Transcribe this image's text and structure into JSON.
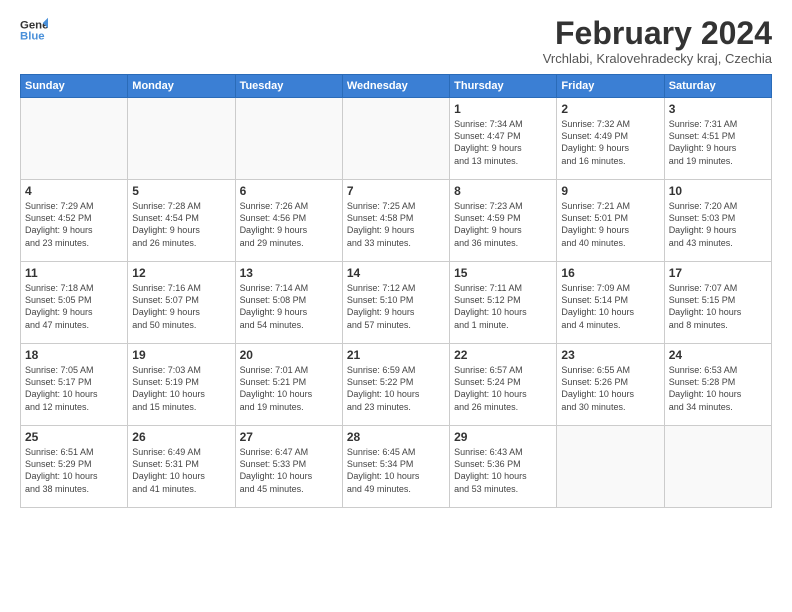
{
  "logo": {
    "line1": "General",
    "line2": "Blue"
  },
  "title": "February 2024",
  "location": "Vrchlabi, Kralovehradecky kraj, Czechia",
  "days_header": [
    "Sunday",
    "Monday",
    "Tuesday",
    "Wednesday",
    "Thursday",
    "Friday",
    "Saturday"
  ],
  "weeks": [
    [
      {
        "day": "",
        "info": ""
      },
      {
        "day": "",
        "info": ""
      },
      {
        "day": "",
        "info": ""
      },
      {
        "day": "",
        "info": ""
      },
      {
        "day": "1",
        "info": "Sunrise: 7:34 AM\nSunset: 4:47 PM\nDaylight: 9 hours\nand 13 minutes."
      },
      {
        "day": "2",
        "info": "Sunrise: 7:32 AM\nSunset: 4:49 PM\nDaylight: 9 hours\nand 16 minutes."
      },
      {
        "day": "3",
        "info": "Sunrise: 7:31 AM\nSunset: 4:51 PM\nDaylight: 9 hours\nand 19 minutes."
      }
    ],
    [
      {
        "day": "4",
        "info": "Sunrise: 7:29 AM\nSunset: 4:52 PM\nDaylight: 9 hours\nand 23 minutes."
      },
      {
        "day": "5",
        "info": "Sunrise: 7:28 AM\nSunset: 4:54 PM\nDaylight: 9 hours\nand 26 minutes."
      },
      {
        "day": "6",
        "info": "Sunrise: 7:26 AM\nSunset: 4:56 PM\nDaylight: 9 hours\nand 29 minutes."
      },
      {
        "day": "7",
        "info": "Sunrise: 7:25 AM\nSunset: 4:58 PM\nDaylight: 9 hours\nand 33 minutes."
      },
      {
        "day": "8",
        "info": "Sunrise: 7:23 AM\nSunset: 4:59 PM\nDaylight: 9 hours\nand 36 minutes."
      },
      {
        "day": "9",
        "info": "Sunrise: 7:21 AM\nSunset: 5:01 PM\nDaylight: 9 hours\nand 40 minutes."
      },
      {
        "day": "10",
        "info": "Sunrise: 7:20 AM\nSunset: 5:03 PM\nDaylight: 9 hours\nand 43 minutes."
      }
    ],
    [
      {
        "day": "11",
        "info": "Sunrise: 7:18 AM\nSunset: 5:05 PM\nDaylight: 9 hours\nand 47 minutes."
      },
      {
        "day": "12",
        "info": "Sunrise: 7:16 AM\nSunset: 5:07 PM\nDaylight: 9 hours\nand 50 minutes."
      },
      {
        "day": "13",
        "info": "Sunrise: 7:14 AM\nSunset: 5:08 PM\nDaylight: 9 hours\nand 54 minutes."
      },
      {
        "day": "14",
        "info": "Sunrise: 7:12 AM\nSunset: 5:10 PM\nDaylight: 9 hours\nand 57 minutes."
      },
      {
        "day": "15",
        "info": "Sunrise: 7:11 AM\nSunset: 5:12 PM\nDaylight: 10 hours\nand 1 minute."
      },
      {
        "day": "16",
        "info": "Sunrise: 7:09 AM\nSunset: 5:14 PM\nDaylight: 10 hours\nand 4 minutes."
      },
      {
        "day": "17",
        "info": "Sunrise: 7:07 AM\nSunset: 5:15 PM\nDaylight: 10 hours\nand 8 minutes."
      }
    ],
    [
      {
        "day": "18",
        "info": "Sunrise: 7:05 AM\nSunset: 5:17 PM\nDaylight: 10 hours\nand 12 minutes."
      },
      {
        "day": "19",
        "info": "Sunrise: 7:03 AM\nSunset: 5:19 PM\nDaylight: 10 hours\nand 15 minutes."
      },
      {
        "day": "20",
        "info": "Sunrise: 7:01 AM\nSunset: 5:21 PM\nDaylight: 10 hours\nand 19 minutes."
      },
      {
        "day": "21",
        "info": "Sunrise: 6:59 AM\nSunset: 5:22 PM\nDaylight: 10 hours\nand 23 minutes."
      },
      {
        "day": "22",
        "info": "Sunrise: 6:57 AM\nSunset: 5:24 PM\nDaylight: 10 hours\nand 26 minutes."
      },
      {
        "day": "23",
        "info": "Sunrise: 6:55 AM\nSunset: 5:26 PM\nDaylight: 10 hours\nand 30 minutes."
      },
      {
        "day": "24",
        "info": "Sunrise: 6:53 AM\nSunset: 5:28 PM\nDaylight: 10 hours\nand 34 minutes."
      }
    ],
    [
      {
        "day": "25",
        "info": "Sunrise: 6:51 AM\nSunset: 5:29 PM\nDaylight: 10 hours\nand 38 minutes."
      },
      {
        "day": "26",
        "info": "Sunrise: 6:49 AM\nSunset: 5:31 PM\nDaylight: 10 hours\nand 41 minutes."
      },
      {
        "day": "27",
        "info": "Sunrise: 6:47 AM\nSunset: 5:33 PM\nDaylight: 10 hours\nand 45 minutes."
      },
      {
        "day": "28",
        "info": "Sunrise: 6:45 AM\nSunset: 5:34 PM\nDaylight: 10 hours\nand 49 minutes."
      },
      {
        "day": "29",
        "info": "Sunrise: 6:43 AM\nSunset: 5:36 PM\nDaylight: 10 hours\nand 53 minutes."
      },
      {
        "day": "",
        "info": ""
      },
      {
        "day": "",
        "info": ""
      }
    ]
  ]
}
